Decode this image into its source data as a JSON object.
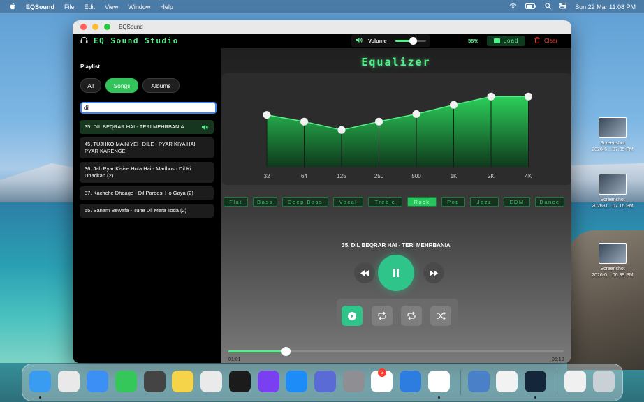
{
  "menubar": {
    "apple": "",
    "app_name": "EQSound",
    "menus": [
      "File",
      "Edit",
      "View",
      "Window",
      "Help"
    ],
    "datetime": "Sun 22 Mar  11:08 PM"
  },
  "desktop": {
    "files": [
      {
        "line1": "Screenshot",
        "line2": "2026-6....07.35 PM"
      },
      {
        "line1": "Screenshot",
        "line2": "2026-0....07.16 PM"
      },
      {
        "line1": "Screenshot",
        "line2": "2026-0....06.39 PM"
      }
    ]
  },
  "window": {
    "title": "EQSound",
    "brand": "EQ Sound Studio",
    "volume_label": "Volume",
    "volume_percent": "58%",
    "volume_value": 0.58,
    "load_label": "Load",
    "clear_label": "Clear"
  },
  "playlist": {
    "heading": "Playlist",
    "filters": [
      "All",
      "Songs",
      "Albums"
    ],
    "active_filter": "Songs",
    "search_value": "dil",
    "songs": [
      {
        "title": "35. DIL BEQRAR HAI - TERI MEHRBANIA",
        "playing": true
      },
      {
        "title": "45. TUJHKO MAIN YEH DILE - PYAR KIYA HAI PYAR KARENGE",
        "playing": false
      },
      {
        "title": "36. Jab Pyar Kisise Hota Hai - Madhosh Dil Ki Dhadkan (2)",
        "playing": false
      },
      {
        "title": "37. Kachche Dhaage - Dil Pardesi Ho Gaya (2)",
        "playing": false
      },
      {
        "title": "55. Sanam Bewafa - Tune Dil Mera Toda (2)",
        "playing": false
      }
    ]
  },
  "equalizer": {
    "title": "Equalizer",
    "bands": [
      "32",
      "64",
      "125",
      "250",
      "500",
      "1K",
      "2K",
      "4K"
    ],
    "gains": [
      0.62,
      0.54,
      0.44,
      0.54,
      0.63,
      0.74,
      0.84,
      0.84
    ],
    "presets": [
      "Flat",
      "Bass",
      "Deep Bass",
      "Vocal",
      "Treble",
      "Rock",
      "Pop",
      "Jazz",
      "EDM",
      "Dance"
    ],
    "active_preset": "Rock"
  },
  "player": {
    "now_playing": "35. DIL BEQRAR HAI - TERI MEHRBANIA",
    "elapsed": "01:01",
    "total": "06:19",
    "progress": 0.17
  },
  "colors": {
    "accent": "#54f08a",
    "play_button": "#2fc58a",
    "clear": "#ff3b30"
  },
  "dock": {
    "apps": [
      "Finder",
      "Launchpad",
      "Safari",
      "Messages",
      "Activity Monitor",
      "Notes",
      "Screenshot",
      "Terminal",
      "SAG",
      "App Store",
      "Simulator",
      "System Settings",
      "Photos",
      "Xcode",
      "Chrome",
      "Time Machine",
      "TextEdit",
      "EQSound",
      "Downloads",
      "Trash"
    ],
    "settings_badge": "2"
  }
}
